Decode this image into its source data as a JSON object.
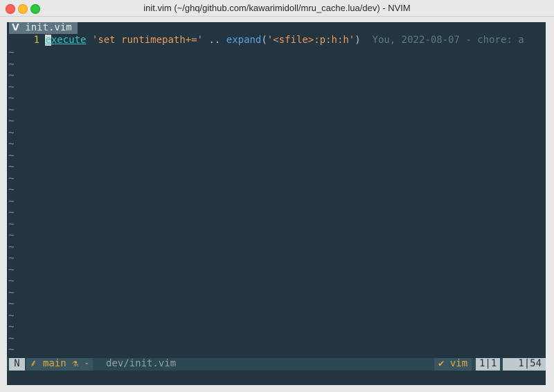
{
  "window": {
    "title": "init.vim (~/ghq/github.com/kawarimidoll/mru_cache.lua/dev) - NVIM"
  },
  "tabline": {
    "tab_icon": "vim-icon",
    "tab_label": "init.vim"
  },
  "buffer": {
    "line_number": "1",
    "cursor_char": "e",
    "keyword_rest": "xecute",
    "string1": "'set runtimepath+='",
    "operator": "..",
    "function": "expand",
    "paren_open": "(",
    "string2": "'<sfile>:p:h:h'",
    "paren_close": ")",
    "blame": "You, 2022-08-07 - chore: a",
    "tilde": "~"
  },
  "statusline": {
    "mode": "N",
    "branch_icon": "git-branch-icon",
    "branch": "main",
    "flask_icon": "flask-icon",
    "diff_marker": "-",
    "path": "dev/init.vim",
    "filetype_icon": "vim-icon",
    "filetype": "vim",
    "position": "1|1",
    "progress": "1|54"
  },
  "colors": {
    "background": "#223540",
    "keyword": "#35c2c7",
    "string": "#ea9a5b",
    "function": "#5aa3e0",
    "line_number": "#e3b44a",
    "accent": "#e0a83c"
  }
}
